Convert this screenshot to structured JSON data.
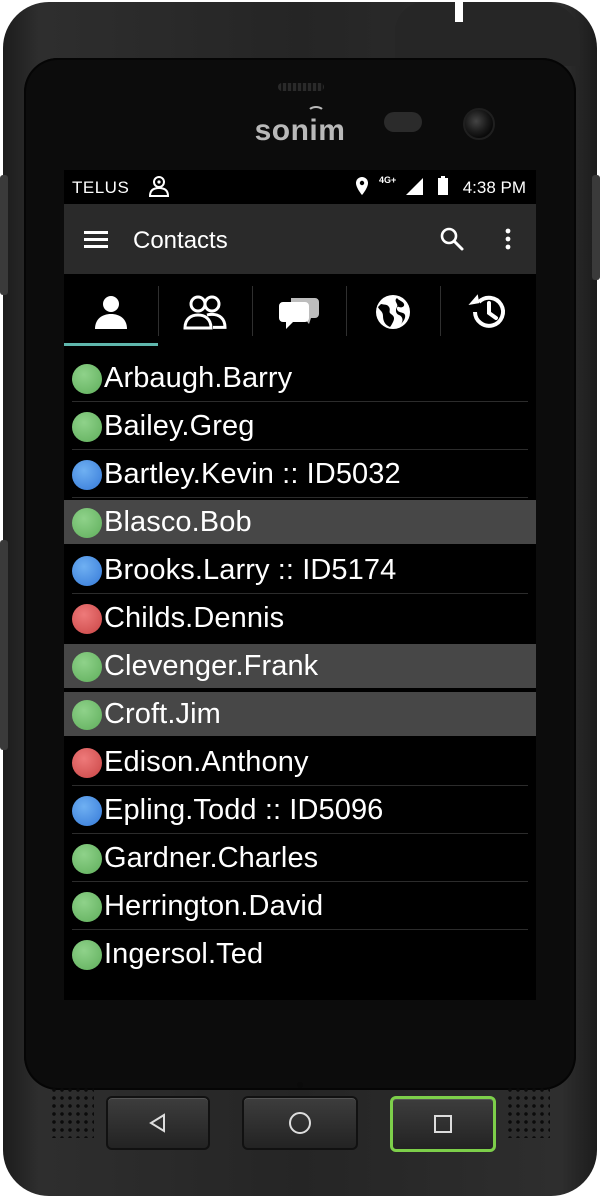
{
  "device": {
    "brand": "sonim"
  },
  "status_bar": {
    "carrier": "TELUS",
    "network": "4G+",
    "time": "4:38 PM",
    "icons": [
      "contacts-group-icon",
      "location-icon",
      "signal-icon",
      "battery-icon"
    ]
  },
  "app_bar": {
    "title": "Contacts",
    "icons": [
      "hamburger-menu-icon",
      "search-icon",
      "overflow-menu-icon"
    ]
  },
  "tabs": [
    {
      "icon": "person-icon",
      "selected": true
    },
    {
      "icon": "group-icon",
      "selected": false
    },
    {
      "icon": "chat-icon",
      "selected": false
    },
    {
      "icon": "globe-icon",
      "selected": false
    },
    {
      "icon": "history-icon",
      "selected": false
    }
  ],
  "contacts": [
    {
      "name": "Arbaugh.Barry",
      "status": "green",
      "highlighted": false
    },
    {
      "name": "Bailey.Greg",
      "status": "green",
      "highlighted": false
    },
    {
      "name": "Bartley.Kevin :: ID5032",
      "status": "blue",
      "highlighted": false
    },
    {
      "name": "Blasco.Bob",
      "status": "green",
      "highlighted": true
    },
    {
      "name": "Brooks.Larry :: ID5174",
      "status": "blue",
      "highlighted": false
    },
    {
      "name": "Childs.Dennis",
      "status": "red",
      "highlighted": false
    },
    {
      "name": "Clevenger.Frank",
      "status": "green",
      "highlighted": true
    },
    {
      "name": "Croft.Jim",
      "status": "green",
      "highlighted": true
    },
    {
      "name": "Edison.Anthony",
      "status": "red",
      "highlighted": false
    },
    {
      "name": "Epling.Todd :: ID5096",
      "status": "blue",
      "highlighted": false
    },
    {
      "name": "Gardner.Charles",
      "status": "green",
      "highlighted": false
    },
    {
      "name": "Herrington.David",
      "status": "green",
      "highlighted": false
    },
    {
      "name": "Ingersol.Ted",
      "status": "green",
      "highlighted": false
    }
  ],
  "colors": {
    "online": "#6fbf6b",
    "dispatch": "#4a8fe3",
    "busy": "#dd5c5c",
    "tab_indicator": "#5fb7ad",
    "recent_key_border": "#7dcf4a"
  },
  "hardware_keys": [
    "back-icon",
    "home-icon",
    "recents-icon"
  ]
}
